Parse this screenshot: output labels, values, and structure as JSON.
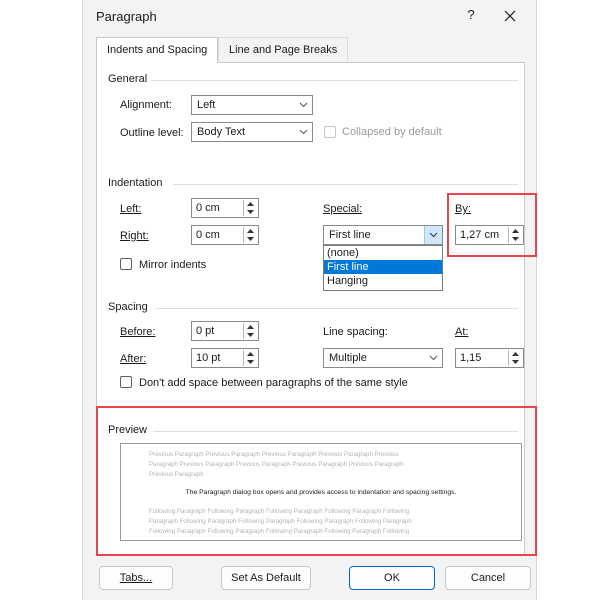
{
  "dialog": {
    "title": "Paragraph",
    "help_label": "?",
    "tabs": [
      {
        "label": "Indents and Spacing",
        "active": true
      },
      {
        "label": "Line and Page Breaks",
        "active": false
      }
    ]
  },
  "general": {
    "section_label": "General",
    "alignment_label": "Alignment:",
    "alignment_value": "Left",
    "outline_label": "Outline level:",
    "outline_value": "Body Text",
    "collapsed_label": "Collapsed by default"
  },
  "indentation": {
    "section_label": "Indentation",
    "left_label": "Left:",
    "left_value": "0 cm",
    "right_label": "Right:",
    "right_value": "0 cm",
    "mirror_label": "Mirror indents",
    "special_label": "Special:",
    "special_value": "First line",
    "special_options": [
      "(none)",
      "First line",
      "Hanging"
    ],
    "special_selected": "First line",
    "by_label": "By:",
    "by_value": "1,27 cm"
  },
  "spacing": {
    "section_label": "Spacing",
    "before_label": "Before:",
    "before_value": "0 pt",
    "after_label": "After:",
    "after_value": "10 pt",
    "line_spacing_label": "Line spacing:",
    "line_spacing_value": "Multiple",
    "at_label": "At:",
    "at_value": "1,15",
    "dont_add_label": "Don't add space between paragraphs of the same style"
  },
  "preview": {
    "section_label": "Preview",
    "previous_lines": [
      "Previous Paragraph Previous Paragraph Previous Paragraph Previous Paragraph Previous",
      "Paragraph Previous Paragraph Previous Paragraph Previous Paragraph Previous Paragraph",
      "Previous Paragraph"
    ],
    "sample_text": "The Paragraph dialog box opens and provides access to indentation and spacing settings.",
    "following_lines": [
      "Following Paragraph Following Paragraph Following Paragraph Following Paragraph Following",
      "Paragraph Following Paragraph Following Paragraph Following Paragraph Following Paragraph",
      "Following Paragraph Following Paragraph Following Paragraph Following Paragraph Following"
    ]
  },
  "buttons": {
    "tabs": "Tabs...",
    "set_default": "Set As Default",
    "ok": "OK",
    "cancel": "Cancel"
  },
  "colors": {
    "highlight_box": "#e8464b",
    "selection": "#0078d7",
    "primary_border": "#0067c0"
  },
  "icons": [
    "close-icon",
    "chevron-down-icon",
    "spin-up-icon",
    "spin-down-icon"
  ]
}
